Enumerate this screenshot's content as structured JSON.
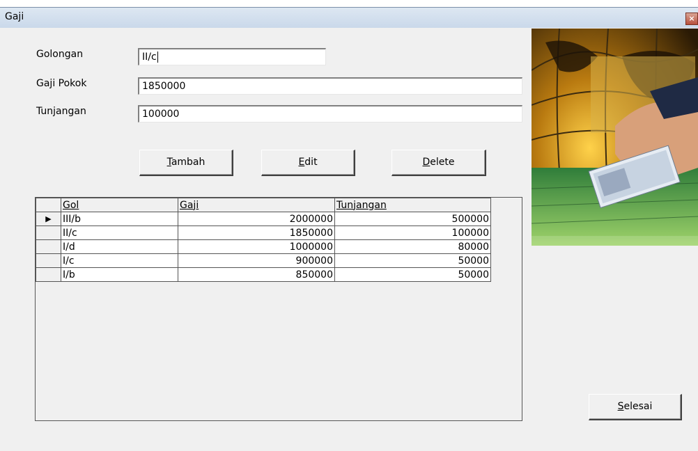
{
  "window": {
    "title": "Gaji",
    "close_glyph": "×"
  },
  "form": {
    "golongan_label": "Golongan",
    "golongan_value": "II/c",
    "gaji_pokok_label": "Gaji Pokok",
    "gaji_pokok_value": "1850000",
    "tunjangan_label": "Tunjangan",
    "tunjangan_value": "100000"
  },
  "buttons": {
    "tambah": {
      "mnemonic": "T",
      "rest": "ambah"
    },
    "edit": {
      "mnemonic": "E",
      "rest": "dit"
    },
    "delete": {
      "mnemonic": "D",
      "rest": "elete"
    },
    "selesai": {
      "mnemonic": "S",
      "rest": "elesai"
    }
  },
  "grid": {
    "columns": [
      "Gol",
      "Gaji",
      "Tunjangan"
    ],
    "rows": [
      {
        "gol": "III/b",
        "gaji": "2000000",
        "tunjangan": "500000"
      },
      {
        "gol": "II/c",
        "gaji": "1850000",
        "tunjangan": "100000"
      },
      {
        "gol": "I/d",
        "gaji": "1000000",
        "tunjangan": "80000"
      },
      {
        "gol": "I/c",
        "gaji": "900000",
        "tunjangan": "50000"
      },
      {
        "gol": "I/b",
        "gaji": "850000",
        "tunjangan": "50000"
      }
    ],
    "current_row_indicator": "▶"
  },
  "image": {
    "icon": "money-hand-keyboard-globe-picture"
  }
}
